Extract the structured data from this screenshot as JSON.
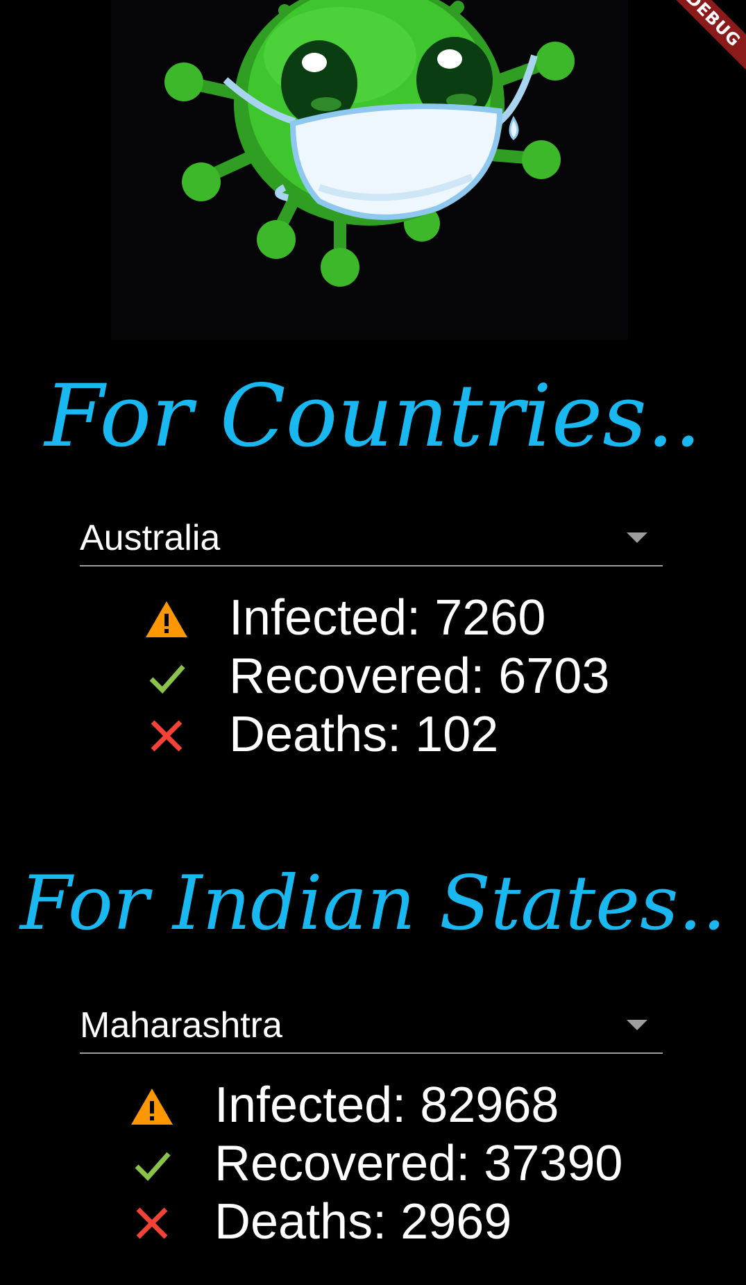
{
  "debug_banner": {
    "label": "DEBUG"
  },
  "hero": {
    "image": "virus-mascot-with-mask"
  },
  "countries": {
    "heading": "For Countries..",
    "selected": "Australia",
    "stats": {
      "infected_label": "Infected:",
      "infected": 7260,
      "recovered_label": "Recovered:",
      "recovered": 6703,
      "deaths_label": "Deaths:",
      "deaths": 102
    }
  },
  "states": {
    "heading": "For Indian States..",
    "selected": "Maharashtra",
    "stats": {
      "infected_label": "Infected:",
      "infected": 82968,
      "recovered_label": "Recovered:",
      "recovered": 37390,
      "deaths_label": "Deaths:",
      "deaths": 2969
    }
  },
  "icons": {
    "infected": "warning-icon",
    "recovered": "check-icon",
    "deaths": "close-icon"
  },
  "colors": {
    "heading": "#1ab8f0",
    "warning": "#ff9800",
    "check": "#8bc34a",
    "cross": "#f44336",
    "background": "#000000"
  }
}
